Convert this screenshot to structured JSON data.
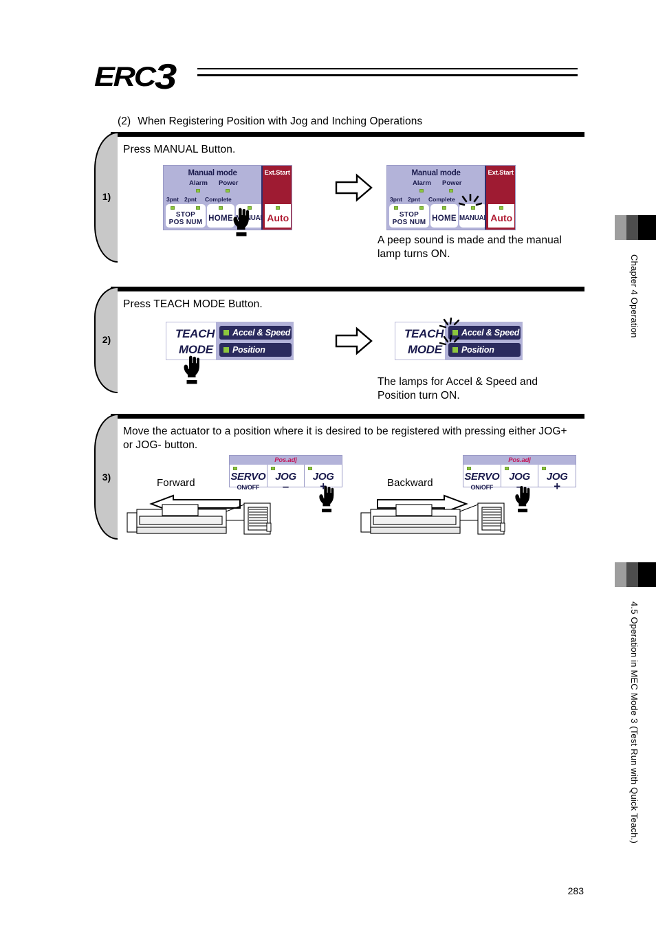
{
  "header": {
    "logo_prefix": "ERC",
    "logo_number": "3"
  },
  "section_title": {
    "number": "(2)",
    "text": "When Registering Position with Jog and Inching Operations"
  },
  "steps": [
    {
      "marker": "1)",
      "instruction": "Press MANUAL Button.",
      "result_text": "A peep sound is made and the manual\nlamp turns ON.",
      "panel_before": {
        "title": "Manual mode",
        "lamp_alarm": "Alarm",
        "lamp_power": "Power",
        "sub_3pnt": "3pnt",
        "sub_2pnt": "2pnt",
        "sub_complete": "Complete",
        "btn_stop_line1": "STOP",
        "btn_stop_line2": "POS NUM",
        "btn_home": "HOME",
        "btn_manual": "MANUAL",
        "ext_start": "Ext.Start",
        "btn_auto": "Auto"
      },
      "panel_after": {
        "title": "Manual mode",
        "lamp_alarm": "Alarm",
        "lamp_power": "Power",
        "sub_3pnt": "3pnt",
        "sub_2pnt": "2pnt",
        "sub_complete": "Complete",
        "btn_stop_line1": "STOP",
        "btn_stop_line2": "POS NUM",
        "btn_home": "HOME",
        "btn_manual": "MANUAL",
        "ext_start": "Ext.Start",
        "btn_auto": "Auto"
      }
    },
    {
      "marker": "2)",
      "instruction": "Press TEACH MODE Button.",
      "result_text": "The lamps for Accel & Speed and\nPosition turn ON.",
      "panel_before": {
        "word_top": "TEACH",
        "word_bottom": "MODE",
        "chip_top": "Accel & Speed",
        "chip_bottom": "Position"
      },
      "panel_after": {
        "word_top": "TEACH",
        "word_bottom": "MODE",
        "chip_top": "Accel & Speed",
        "chip_bottom": "Position"
      }
    },
    {
      "marker": "3)",
      "instruction": "Move the actuator to a position where it is desired to be registered with pressing either JOG+\nor JOG- button.",
      "forward": {
        "direction_label": "Forward",
        "panel_header": "Pos.adj",
        "btn_servo": "SERVO",
        "btn_servo_sub": "ON/OFF",
        "btn_jog_minus": "JOG",
        "btn_jog_minus_sign": "–",
        "btn_jog_plus": "JOG",
        "btn_jog_plus_sign": "+"
      },
      "backward": {
        "direction_label": "Backward",
        "panel_header": "Pos.adj",
        "btn_servo": "SERVO",
        "btn_servo_sub": "ON/OFF",
        "btn_jog_minus": "JOG",
        "btn_jog_minus_sign": "–",
        "btn_jog_plus": "JOG",
        "btn_jog_plus_sign": "+"
      }
    }
  ],
  "sidebar": {
    "chapter_label": "Chapter 4 Operation",
    "section_label": "4.5 Operation in MEC Mode 3 (Test Run with Quick Teach.)"
  },
  "page_number": "283",
  "colors": {
    "panel_lavender": "#b3b3d9",
    "panel_navy": "#1b1b4d",
    "chip_navy": "#2b2b5e",
    "led_green": "#8cc63e",
    "ext_start_red": "#9e1b32",
    "auto_red": "#b01b32",
    "posadj_pink": "#c2185b",
    "tab_gray": "#c8c8c8"
  }
}
